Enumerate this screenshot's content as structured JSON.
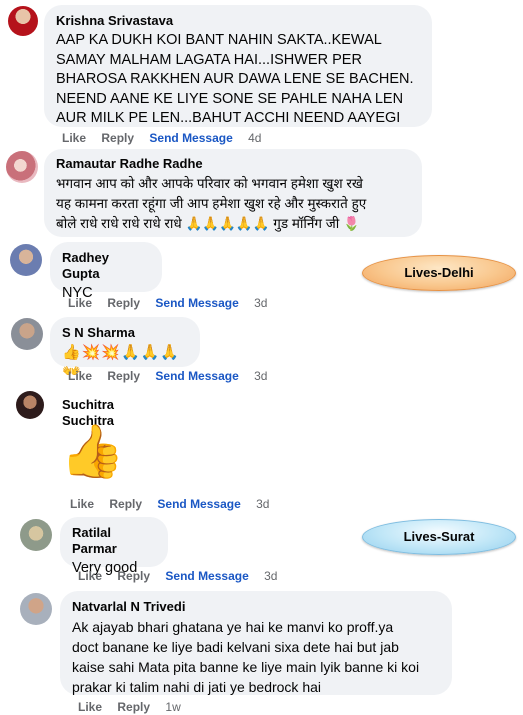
{
  "comments": [
    {
      "name": "Krishna Srivastava",
      "lines": [
        "AAP KA DUKH KOI BANT NAHIN SAKTA..KEWAL",
        "SAMAY MALHAM LAGATA HAI...ISHWER PER",
        "BHAROSA RAKKHEN AUR DAWA LENE SE BACHEN.",
        "NEEND AANE KE LIYE SONE SE PAHLE NAHA LEN",
        "AUR MILK PE LEN...BAHUT ACCHI NEEND AAYEGI"
      ],
      "like": "Like",
      "reply": "Reply",
      "send": "Send Message",
      "time": "4d"
    },
    {
      "name": "Ramautar Radhe Radhe",
      "lines": [
        "भगवान आप को और आपके परिवार को भगवान हमेशा खुश रखे",
        "यह कामना करता रहूंगा जी आप हमेशा खुश रहे और मुस्कराते हुए",
        "बोले राधे राधे राधे राधे राधे 🙏🙏🙏🙏🙏 गुड मॉर्निंग जी 🌷"
      ]
    },
    {
      "name": "Radhey Gupta",
      "text": "NYC",
      "like": "Like",
      "reply": "Reply",
      "send": "Send Message",
      "time": "3d"
    },
    {
      "name": "S N Sharma",
      "text": "👍💥💥🙏🙏🙏👐",
      "like": "Like",
      "reply": "Reply",
      "send": "Send Message",
      "time": "3d"
    },
    {
      "name": "Suchitra Suchitra",
      "sticker": "👍",
      "like": "Like",
      "reply": "Reply",
      "send": "Send Message",
      "time": "3d"
    },
    {
      "name": "Ratilal Parmar",
      "text": "Very good",
      "like": "Like",
      "reply": "Reply",
      "send": "Send Message",
      "time": "3d"
    },
    {
      "name": "Natvarlal N Trivedi",
      "lines": [
        "Ak ajayab bhari ghatana ye hai ke manvi ko proff.ya",
        "doct banane ke liye badi kelvani sixa dete hai but jab",
        "kaise sahi Mata pita banne ke liye main lyik banne ki koi",
        "prakar ki talim nahi di jati ye bedrock hai"
      ],
      "like": "Like",
      "reply": "Reply",
      "time": "1w"
    }
  ],
  "tags": {
    "delhi": "Lives-Delhi",
    "surat": "Lives-Surat"
  },
  "colors": {
    "bubble": "#f0f2f5",
    "action": "#65676b",
    "send": "#1a57c4"
  }
}
